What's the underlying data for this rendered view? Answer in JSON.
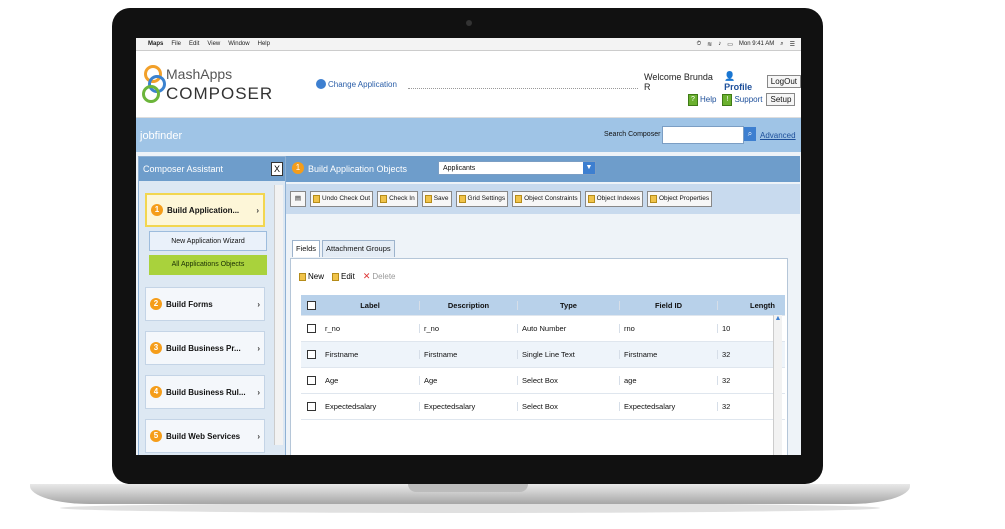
{
  "menubar": {
    "items": [
      "Maps",
      "File",
      "Edit",
      "View",
      "Window",
      "Help"
    ],
    "clock": "Mon 9:41 AM"
  },
  "header": {
    "logo_line1": "MashApps",
    "logo_line2": "COMPOSER",
    "change_app": "Change Application",
    "welcome": "Welcome Brunda R",
    "profile": "Profile",
    "logout": "LogOut",
    "help": "Help",
    "support": "Support",
    "setup": "Setup"
  },
  "searchbar": {
    "breadcrumb": "jobfinder",
    "label": "Search Composer",
    "input_value": "",
    "advanced": "Advanced"
  },
  "sidebar": {
    "title": "Composer Assistant",
    "close": "X",
    "steps": [
      {
        "num": "1",
        "label": "Build Application...",
        "active": true
      },
      {
        "num": "2",
        "label": "Build Forms",
        "active": false
      },
      {
        "num": "3",
        "label": "Build Business Pr...",
        "active": false
      },
      {
        "num": "4",
        "label": "Build Business Rul...",
        "active": false
      },
      {
        "num": "5",
        "label": "Build Web Services",
        "active": false
      }
    ],
    "subitems": [
      "New Application Wizard",
      "All Applications Objects"
    ]
  },
  "main": {
    "step_num": "1",
    "title": "Build Application Objects",
    "selected_object": "Applicants",
    "toolbar": [
      "Undo Check Out",
      "Check In",
      "Save",
      "Grid Settings",
      "Object Constraints",
      "Object Indexes",
      "Object Properties"
    ],
    "tabs": [
      "Fields",
      "Attachment Groups"
    ],
    "actions": {
      "new": "New",
      "edit": "Edit",
      "delete": "Delete"
    },
    "columns": [
      "Label",
      "Description",
      "Type",
      "Field ID",
      "Length"
    ],
    "rows": [
      {
        "label": "r_no",
        "description": "r_no",
        "type": "Auto Number",
        "field_id": "rno",
        "length": "10"
      },
      {
        "label": "Firstname",
        "description": "Firstname",
        "type": "Single Line Text",
        "field_id": "Firstname",
        "length": "32"
      },
      {
        "label": "Age",
        "description": "Age",
        "type": "Select Box",
        "field_id": "age",
        "length": "32"
      },
      {
        "label": "Expectedsalary",
        "description": "Expectedsalary",
        "type": "Select Box",
        "field_id": "Expectedsalary",
        "length": "32"
      }
    ]
  }
}
